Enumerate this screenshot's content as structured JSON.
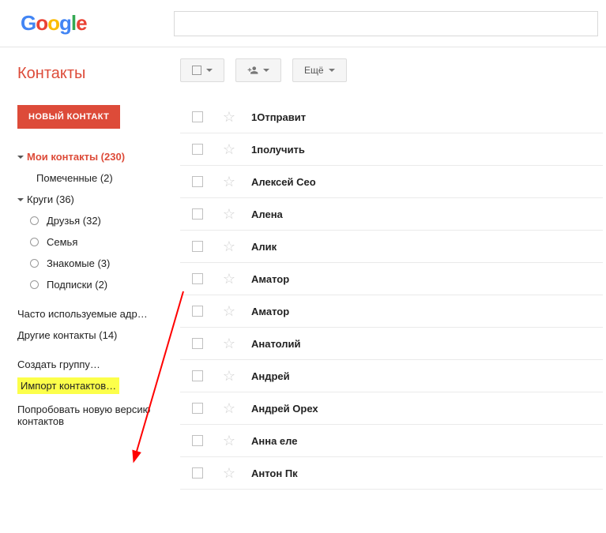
{
  "header": {
    "search_placeholder": ""
  },
  "sidebar": {
    "app_title": "Контакты",
    "new_button": "НОВЫЙ КОНТАКТ",
    "my_contacts": {
      "label": "Мои контакты (230)"
    },
    "starred": {
      "label": "Помеченные (2)"
    },
    "circles": {
      "label": "Круги (36)",
      "items": [
        "Друзья (32)",
        "Семья",
        "Знакомые (3)",
        "Подписки (2)"
      ]
    },
    "links": {
      "frequent": "Часто используемые адр…",
      "other": "Другие контакты (14)",
      "create_group": "Создать группу…",
      "import": "Импорт контактов…",
      "try_new": "Попробовать новую версию контактов"
    }
  },
  "toolbar": {
    "more_label": "Ещё"
  },
  "contacts": [
    "1Отправит",
    "1получить",
    "Алексей Сео",
    "Алена",
    "Алик",
    "Аматор",
    "Аматор",
    "Анатолий",
    "Андрей",
    "Андрей Орех",
    "Анна еле",
    "Антон Пк"
  ]
}
